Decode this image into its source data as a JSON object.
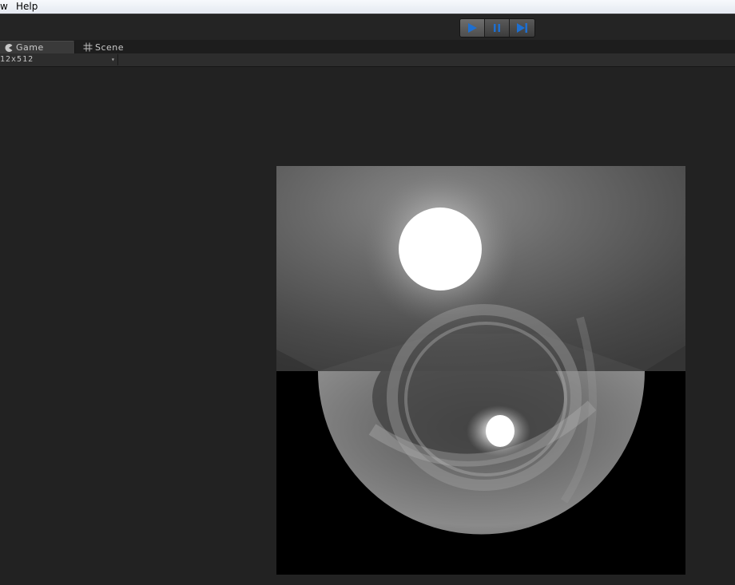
{
  "menubar": {
    "items": [
      "w",
      "Help"
    ]
  },
  "toolbar": {
    "play_icon": "play-icon",
    "pause_icon": "pause-icon",
    "step_icon": "step-icon",
    "accent_color": "#1e6fd0"
  },
  "tabs": [
    {
      "label": "Game",
      "icon": "pacman-icon",
      "active": true
    },
    {
      "label": "Scene",
      "icon": "grid-icon",
      "active": false
    }
  ],
  "game_view": {
    "resolution": "12x512",
    "resolution_arrow": "▾"
  }
}
